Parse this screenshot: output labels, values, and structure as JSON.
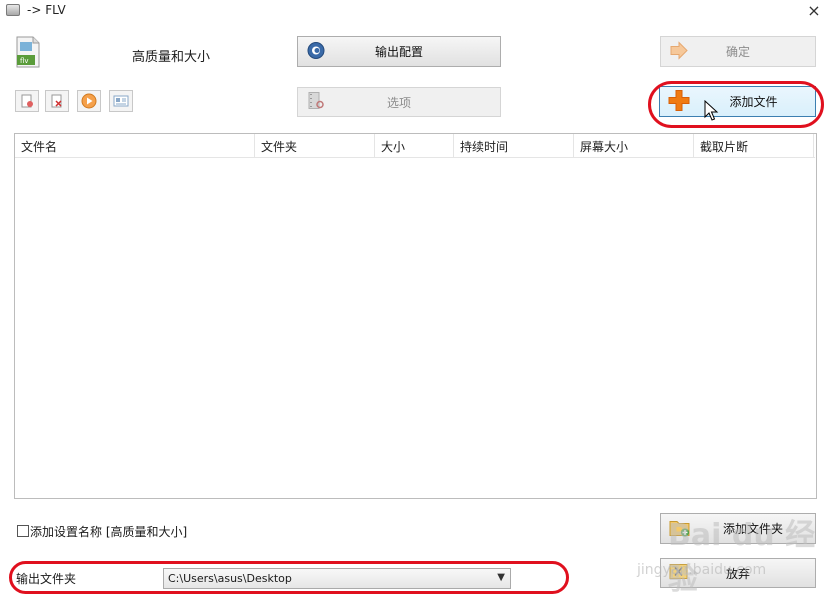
{
  "window": {
    "title": "-> FLV",
    "close_glyph": "×"
  },
  "preset": {
    "label": "高质量和大小"
  },
  "buttons": {
    "output_config": "输出配置",
    "options": "选项",
    "ok": "确定",
    "add_file": "添加文件",
    "add_folder": "添加文件夹",
    "cancel": "放弃"
  },
  "table": {
    "columns": [
      "文件名",
      "文件夹",
      "大小",
      "持续时间",
      "屏幕大小",
      "截取片断"
    ]
  },
  "add_setting_name": {
    "label": "添加设置名称 [高质量和大小]",
    "checked": false
  },
  "output_folder": {
    "label": "输出文件夹",
    "value": "C:\\Users\\asus\\Desktop"
  },
  "watermark": {
    "line1": "Bai du 经验",
    "line2": "jingyan.baidu.com"
  },
  "colors": {
    "callout": "#e0101e",
    "accent": "#3c7fb1",
    "orange_plus": "#f07b12"
  }
}
